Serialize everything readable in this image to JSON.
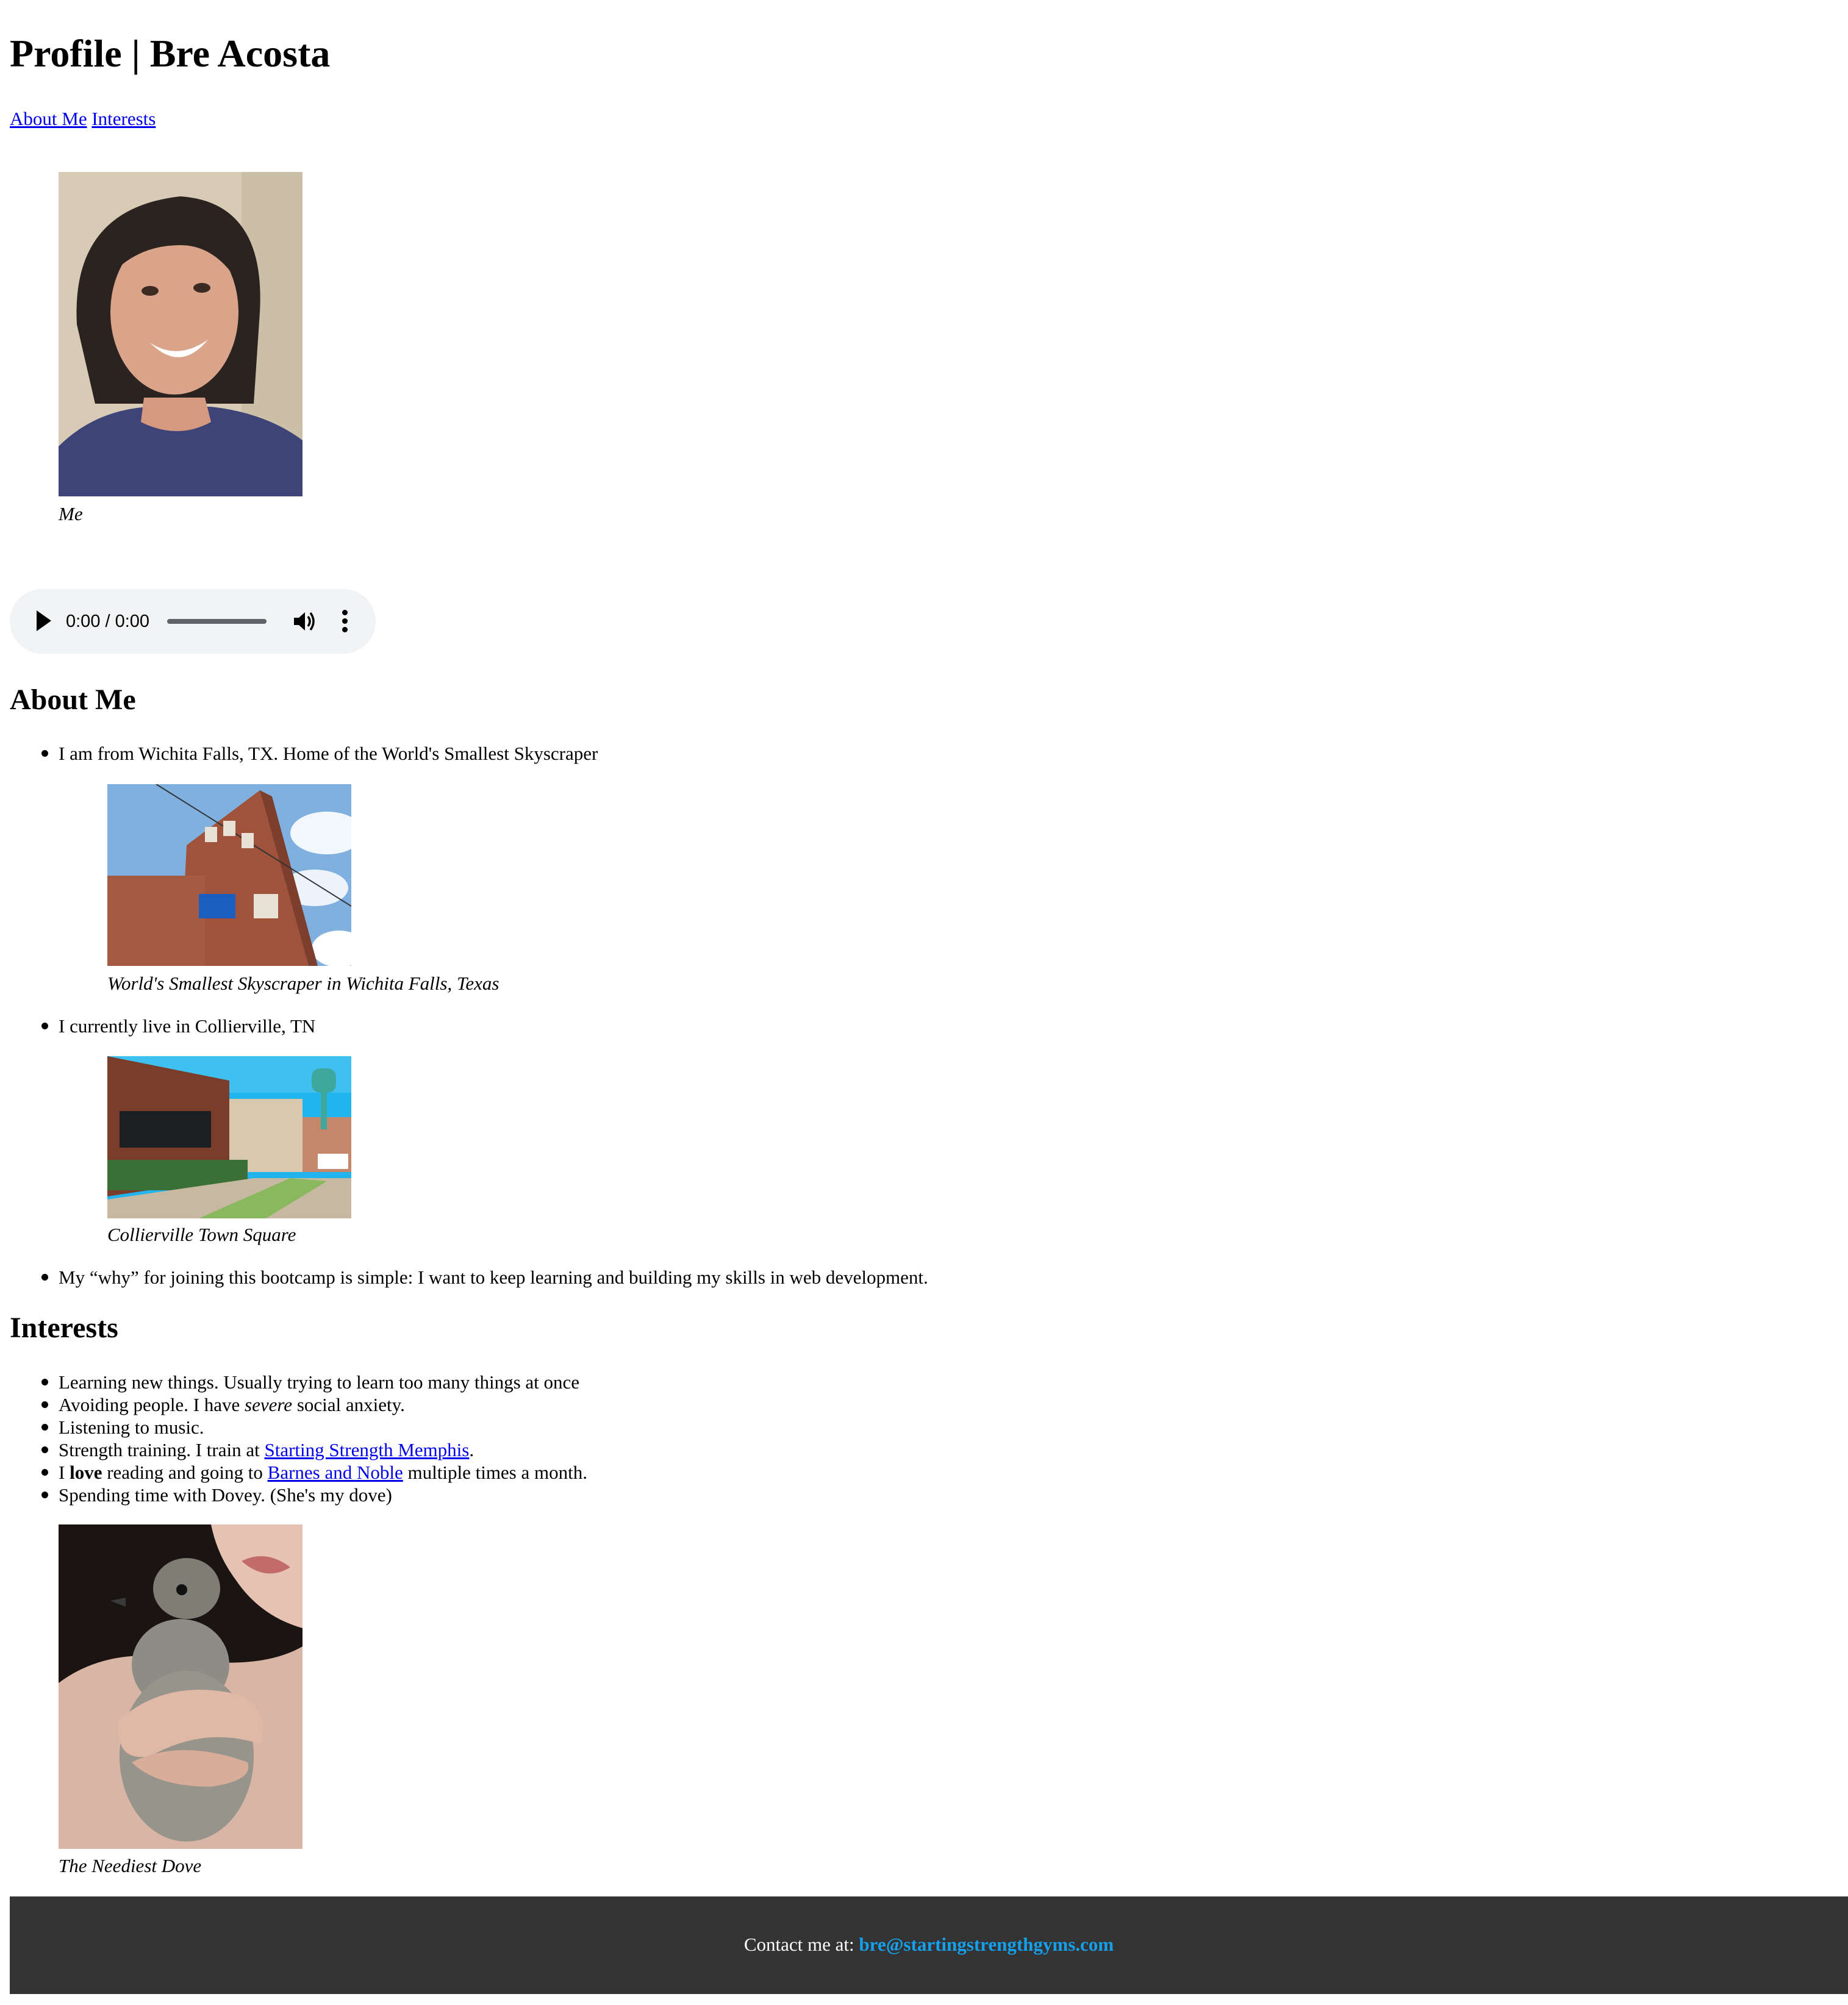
{
  "header": {
    "title": "Profile | Bre Acosta",
    "nav": [
      "About Me",
      "Interests"
    ]
  },
  "profile": {
    "photo_icon": "portrait-photo",
    "caption": "Me"
  },
  "audio": {
    "time": "0:00 / 0:00",
    "progress": 0
  },
  "about": {
    "heading": "About Me",
    "item1": "I am from Wichita Falls, TX. Home of the World's Smallest Skyscraper",
    "item1_caption": "World's Smallest Skyscraper in Wichita Falls, Texas",
    "item2": "I currently live in Collierville, TN",
    "item2_caption": "Collierville Town Square",
    "item3": "My “why” for joining this bootcamp is simple: I want to keep learning and building my skills in web development."
  },
  "interests": {
    "heading": "Interests",
    "i1": "Learning new things. Usually trying to learn too many things at once",
    "i2_pre": "Avoiding people. I have ",
    "i2_em": "severe",
    "i2_post": " social anxiety.",
    "i3": "Listening to music.",
    "i4_pre": "Strength training. I train at ",
    "i4_link": "Starting Strength Memphis",
    "i4_post": ".",
    "i5_pre": "I ",
    "i5_strong": "love",
    "i5_mid": " reading and going to ",
    "i5_link": "Barnes and Noble",
    "i5_post": " multiple times a month.",
    "i6": "Spending time with Dovey. (She's my dove)",
    "dove_caption": "The Neediest Dove"
  },
  "footer": {
    "label": "Contact me at: ",
    "email": "bre@startingstrengthgyms.com"
  },
  "colors": {
    "link": "#0000ee",
    "footer_bg": "#333333",
    "email": "#14a0ed",
    "player_bg": "#f1f3f4"
  }
}
